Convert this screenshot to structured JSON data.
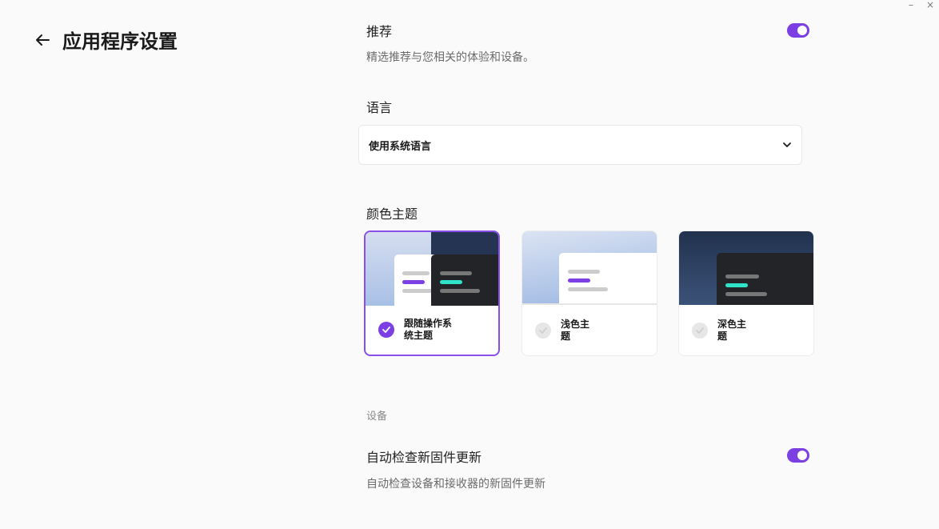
{
  "window": {
    "minimize_glyph": "–",
    "close_glyph": "×"
  },
  "header": {
    "back_icon": "arrow-left-icon",
    "title": "应用程序设置"
  },
  "recommendations": {
    "title": "推荐",
    "description": "精选推荐与您相关的体验和设备。",
    "enabled": true
  },
  "language": {
    "heading": "语言",
    "selected": "使用系统语言",
    "dropdown_icon": "chevron-down-icon"
  },
  "theme": {
    "heading": "颜色主题",
    "options": [
      {
        "label_line1": "跟随操作系",
        "label_line2": "统主题",
        "selected": true
      },
      {
        "label_line1": "浅色主",
        "label_line2": "题",
        "selected": false
      },
      {
        "label_line1": "深色主",
        "label_line2": "题",
        "selected": false
      }
    ]
  },
  "devices": {
    "heading": "设备",
    "firmware_title": "自动检查新固件更新",
    "firmware_description": "自动检查设备和接收器的新固件更新",
    "firmware_enabled": true
  },
  "colors": {
    "accent": "#7b3fe4",
    "teal": "#2ee3c8",
    "dark": "#232428"
  }
}
